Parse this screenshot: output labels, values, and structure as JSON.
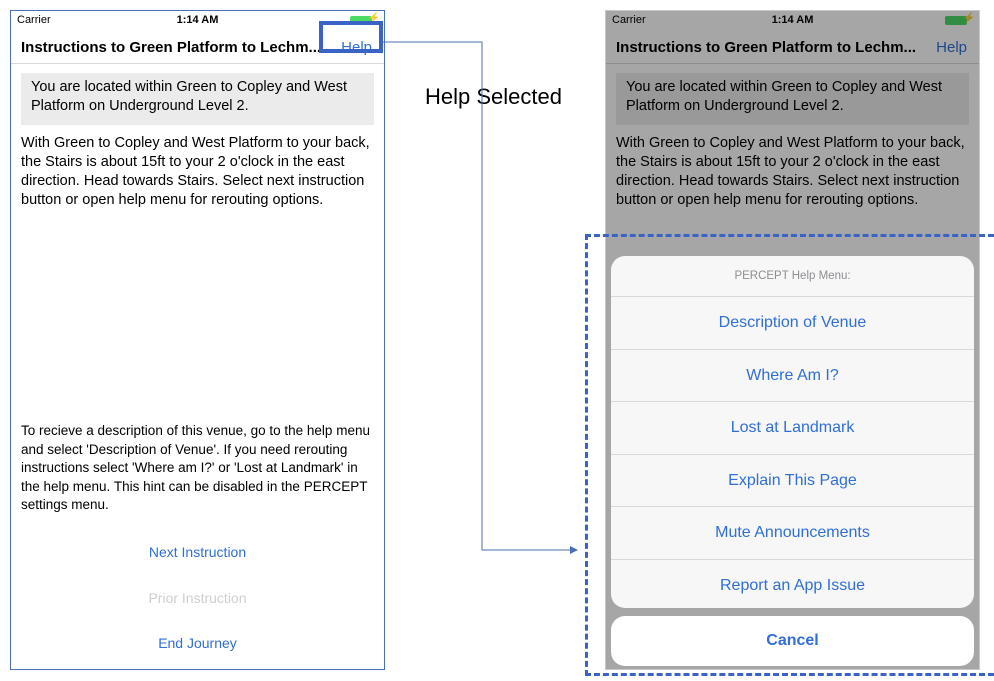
{
  "status_bar": {
    "carrier": "Carrier",
    "time": "1:14 AM"
  },
  "nav": {
    "title_left": "Instructions to Green Platform to Lechm...",
    "title_right": "Instructions to Green Platform to Lechm...",
    "help_label": "Help"
  },
  "location_banner": "You are located within Green to Copley and West Platform  on Underground Level 2.",
  "instruction_text": "With Green to Copley and West Platform to your back, the Stairs is about 15ft to your 2 o'clock in the east direction.  Head towards Stairs.  Select next instruction button or open help menu for rerouting options.",
  "hint_text": "To recieve a description of this venue, go to the help menu and select 'Description of Venue'. If you need rerouting instructions select 'Where am I?' or 'Lost at Landmark' in the help menu. This hint can be disabled in the PERCEPT settings menu.",
  "actions": {
    "next": "Next Instruction",
    "prior": "Prior Instruction",
    "end": "End Journey"
  },
  "annotation_label": "Help  Selected",
  "help_menu": {
    "title": "PERCEPT Help Menu:",
    "items": [
      "Description of Venue",
      "Where Am I?",
      "Lost at Landmark",
      "Explain This Page",
      "Mute Announcements",
      "Report an App Issue"
    ],
    "cancel": "Cancel"
  },
  "colors": {
    "accent": "#2f6fd6",
    "highlight": "#3a63c6",
    "disabled": "#cfcfcf"
  }
}
